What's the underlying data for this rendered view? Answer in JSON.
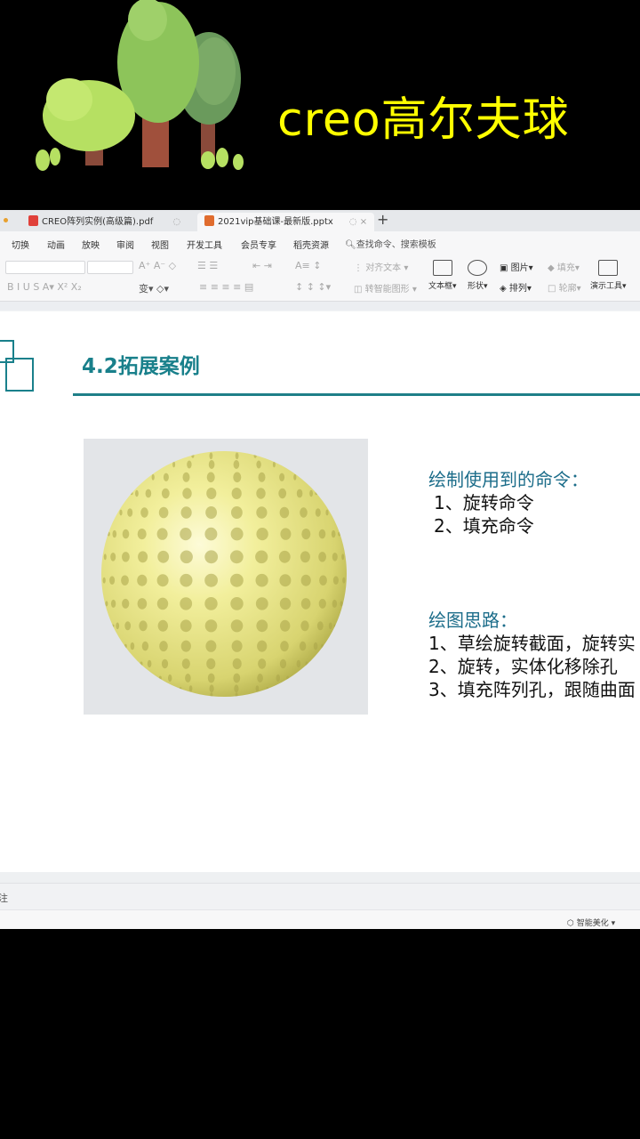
{
  "banner": {
    "title": "creo高尔夫球"
  },
  "tabs": [
    {
      "label": "CREO阵列实例(高级篇).pdf",
      "icon": "pdf-icon"
    },
    {
      "label": "2021vip基础课-最新版.pptx",
      "icon": "pptx-icon"
    }
  ],
  "menu": {
    "items": [
      "切换",
      "动画",
      "放映",
      "审阅",
      "视图",
      "开发工具",
      "会员专享",
      "稻壳资源"
    ],
    "search": "查找命令、搜索模板"
  },
  "toolbar": {
    "align_text": "对齐文本",
    "smart_shape": "转智能图形",
    "text_box": "文本框",
    "shape": "形状",
    "picture": "图片",
    "arrange": "排列",
    "fill": "填充",
    "outline": "轮廓",
    "present_tools": "演示工具"
  },
  "slide": {
    "title": "4.2拓展案例",
    "commands_heading": "绘制使用到的命令：",
    "commands": [
      "1、旋转命令",
      "2、填充命令"
    ],
    "ideas_heading": "绘图思路：",
    "ideas": [
      "1、草绘旋转截面，旋转实",
      "2、旋转，实体化移除孔",
      "3、填充阵列孔，跟随曲面"
    ]
  },
  "notes_label": "注",
  "status": {
    "smart_beautify": "智能美化"
  },
  "colors": {
    "accent": "#19808b",
    "banner_text": "#ffff00",
    "ball": "#f0ee9a"
  }
}
